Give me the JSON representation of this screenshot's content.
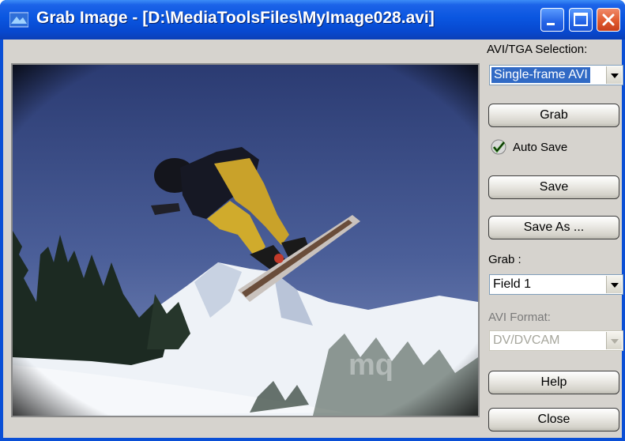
{
  "window": {
    "title": "Grab Image - [D:\\MediaToolsFiles\\MyImage028.avi]",
    "icon": "app-icon",
    "controls": [
      "minimize-icon",
      "maximize-icon",
      "close-icon"
    ]
  },
  "sidebar": {
    "selection_label": "AVI/TGA Selection:",
    "selection_value": "Single-frame AVI",
    "grab_button": "Grab",
    "autosave_label": "Auto Save",
    "autosave_checked": true,
    "save_button": "Save",
    "save_as_button": "Save As ...",
    "grab_label": "Grab :",
    "grab_value": "Field 1",
    "format_label": "AVI Format:",
    "format_value": "DV/DVCAM",
    "help_button": "Help",
    "close_button": "Close"
  },
  "preview": {
    "description_icon": "snowboarder-photo",
    "watermark": "mq"
  },
  "colors": {
    "title_bar": "#0a56e0",
    "dialog_bg": "#d6d3ce",
    "selection_highlight": "#316ac5"
  }
}
